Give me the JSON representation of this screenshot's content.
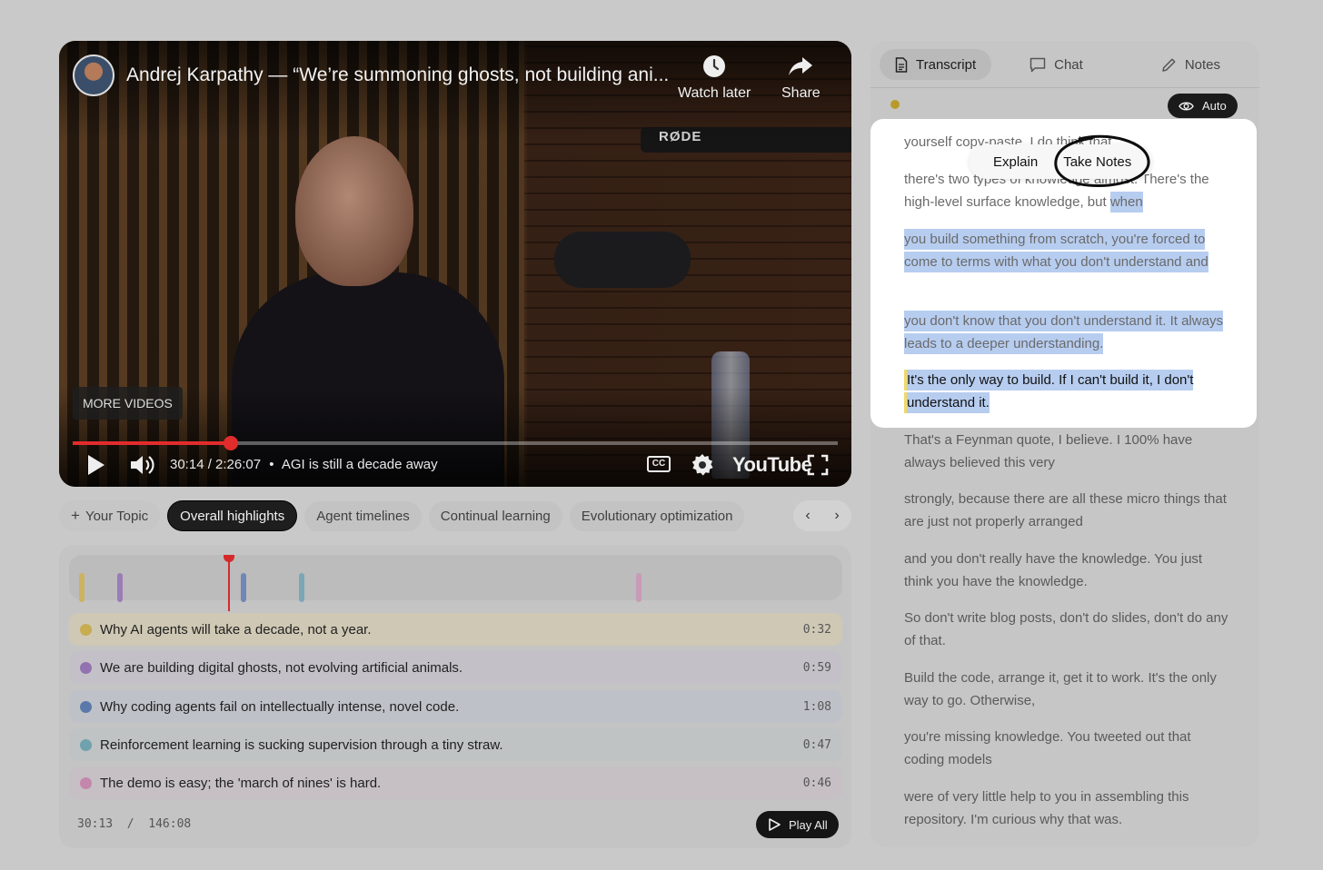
{
  "video": {
    "title": "Andrej Karpathy — “We’re summoning ghosts, not building ani...",
    "watch_later_label": "Watch later",
    "share_label": "Share",
    "more_videos_label": "MORE VIDEOS",
    "time_display": "30:14 / 2:26:07",
    "chapter_separator": "•",
    "chapter": "AGI is still a decade away",
    "progress_fraction": 0.2065,
    "cc_label": "CC",
    "youtube_label": "YouTube",
    "mic_brand": "RØDE"
  },
  "topics": {
    "add_label": "Your Topic",
    "chips": [
      "Overall highlights",
      "Agent timelines",
      "Continual learning",
      "Evolutionary optimization"
    ],
    "active_index": 0
  },
  "highlights": {
    "timeline_marks": [
      {
        "fraction": 0.013,
        "color": "#cdb35f"
      },
      {
        "fraction": 0.062,
        "color": "#9a7cb6"
      },
      {
        "fraction": 0.222,
        "color": "#6e87b6"
      },
      {
        "fraction": 0.297,
        "color": "#7ba6b6"
      },
      {
        "fraction": 0.733,
        "color": "#c79ab6"
      }
    ],
    "playhead_fraction": 0.206,
    "items": [
      {
        "text": "Why AI agents will take a decade, not a year.",
        "time": "0:32",
        "color": "#c8ac50",
        "bg": "#cfc8b4"
      },
      {
        "text": "We are building digital ghosts, not evolving artificial animals.",
        "time": "0:59",
        "color": "#9273b0",
        "bg": "#c4c0c8"
      },
      {
        "text": "Why coding agents fail on intellectually intense, novel code.",
        "time": "1:08",
        "color": "#5a78aa",
        "bg": "#bec2c8"
      },
      {
        "text": "Reinforcement learning is sucking supervision through a tiny straw.",
        "time": "0:47",
        "color": "#6fa2ae",
        "bg": "#bfc3c4"
      },
      {
        "text": "The demo is easy; the 'march of nines' is hard.",
        "time": "0:46",
        "color": "#c486ab",
        "bg": "#c6c0c4"
      }
    ],
    "footer_time": "30:13  /  146:08",
    "play_all_label": "Play All"
  },
  "panel": {
    "tabs": [
      "Transcript",
      "Chat",
      "Notes"
    ],
    "auto_label": "Auto",
    "popup": {
      "explain_label": "Explain",
      "take_notes_label": "Take Notes"
    },
    "focus": {
      "p1": "yourself copy-paste. I do think that",
      "p2_plain": "there's two types of knowledge almost. There's the high-level surface knowledge, but ",
      "p2_sel": "when",
      "p3": "you build something from scratch, you're forced to  come to terms with what you don't understand and",
      "p4": "you don't know that you don't understand it. It always leads to a deeper understanding.",
      "p5": "It's the only way to build. If I can't build it, I don't understand it."
    },
    "transcript": [
      "That's a Feynman quote, I believe. I 100% have always believed this very",
      "strongly, because there are all these micro  things that are just not properly arranged",
      "and you don't really have the knowledge. You just think you have the knowledge.",
      "So don't write blog posts, don't  do slides, don't do any of that.",
      "Build the code, arrange it, get it to work. It's the only way to go. Otherwise,",
      "you're missing knowledge. You tweeted out that coding models",
      "were of very little help to you in assembling  this repository. I'm curious why that was."
    ]
  }
}
